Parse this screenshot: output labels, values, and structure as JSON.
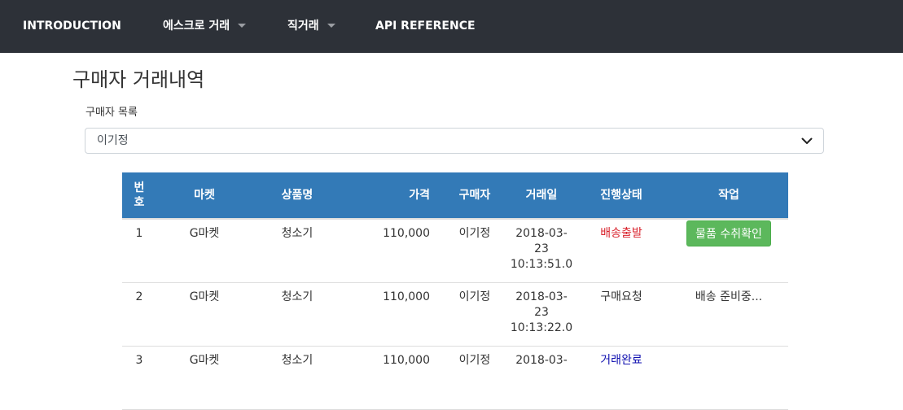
{
  "nav": {
    "items": [
      {
        "label": "INTRODUCTION",
        "dropdown": false
      },
      {
        "label": "에스크로 거래",
        "dropdown": true
      },
      {
        "label": "직거래",
        "dropdown": true
      },
      {
        "label": "API REFERENCE",
        "dropdown": false
      }
    ]
  },
  "page": {
    "title": "구매자 거래내역"
  },
  "buyer_select": {
    "label": "구매자 목록",
    "selected": "이기정"
  },
  "table": {
    "headers": [
      "번호",
      "마켓",
      "상품명",
      "가격",
      "구매자",
      "거래일",
      "진행상태",
      "작업"
    ],
    "header_no_line1": "번",
    "header_no_line2": "호",
    "rows": [
      {
        "no": "1",
        "market": "G마켓",
        "product": "청소기",
        "price": "110,000",
        "buyer": "이기정",
        "date_line1": "2018-03-",
        "date_line2": "23",
        "date_line3": "10:13:51.0",
        "status": "배송출발",
        "action": "물품 수취확인"
      },
      {
        "no": "2",
        "market": "G마켓",
        "product": "청소기",
        "price": "110,000",
        "buyer": "이기정",
        "date_line1": "2018-03-",
        "date_line2": "23",
        "date_line3": "10:13:22.0",
        "status": "구매요청",
        "action": "배송 준비중..."
      },
      {
        "no": "3",
        "market": "G마켓",
        "product": "청소기",
        "price": "110,000",
        "buyer": "이기정",
        "date_line1": "2018-03-",
        "date_line2": "",
        "date_line3": "",
        "status": "거래완료",
        "action": ""
      }
    ]
  },
  "colors": {
    "navbar_bg": "#2d3138",
    "table_header_bg": "#337ab7",
    "confirm_button": "#5cb85c",
    "status_shipping": "#d9232d",
    "status_complete": "#1010b0"
  }
}
